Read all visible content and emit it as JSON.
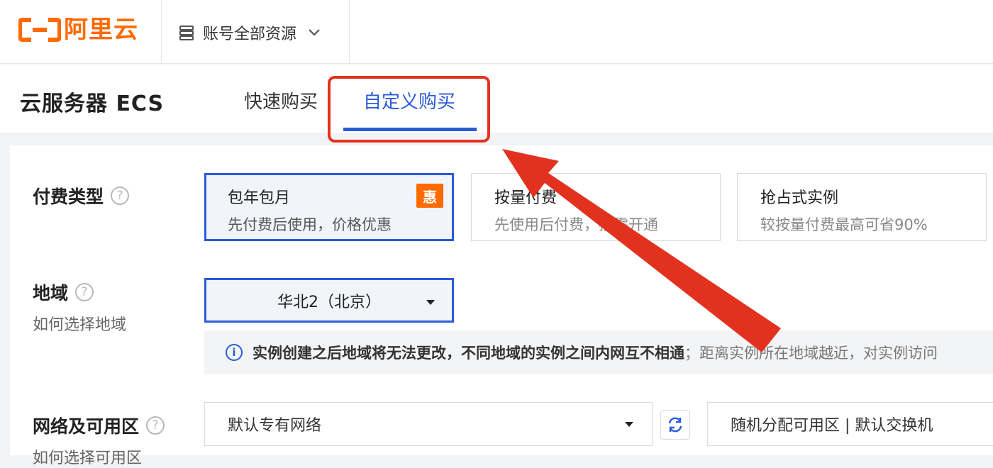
{
  "topbar": {
    "brand_name": "阿里云",
    "brand_color": "#ff6a00",
    "resource_selector": "账号全部资源",
    "resource_icon": "server-stack-icon",
    "dropdown_icon": "chevron-down-icon"
  },
  "header": {
    "page_title": "云服务器 ECS",
    "tabs": [
      {
        "label": "快速购买",
        "active": false
      },
      {
        "label": "自定义购买",
        "active": true
      }
    ],
    "accent_color": "#2a5bd7",
    "annotation_color": "#e2321f"
  },
  "billing": {
    "label": "付费类型",
    "help_icon": "question-icon",
    "options": [
      {
        "title": "包年包月",
        "desc": "先付费后使用，价格优惠",
        "badge": "惠",
        "selected": true
      },
      {
        "title": "按量付费",
        "desc": "先使用后付费，按需开通",
        "selected": false
      },
      {
        "title": "抢占式实例",
        "desc": "较按量付费最高可省90%",
        "selected": false
      }
    ]
  },
  "region": {
    "label": "地域",
    "help_link": "如何选择地域",
    "selected": "华北2（北京）",
    "notice_icon": "info-icon",
    "notice_bold": "实例创建之后地域将无法更改，不同地域的实例之间内网互不相通",
    "notice_rest": "；距离实例所在地域越近，对实例访问"
  },
  "network": {
    "label": "网络及可用区",
    "help_link": "如何选择可用区",
    "vpc_selected": "默认专有网络",
    "refresh_icon": "refresh-icon",
    "zone_selected": "随机分配可用区 | 默认交换机"
  }
}
